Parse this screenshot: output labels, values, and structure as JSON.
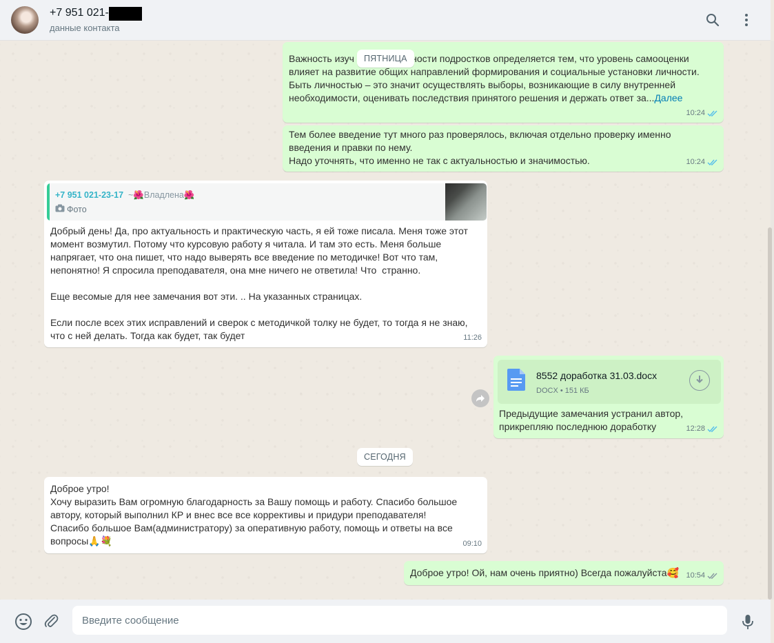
{
  "header": {
    "contact_name": "+7 951 021-",
    "contact_subtitle": "данные контакта",
    "icons": [
      "search-icon",
      "menu-icon"
    ]
  },
  "days": {
    "friday": "ПЯТНИЦА",
    "today": "СЕГОДНЯ"
  },
  "messages": {
    "m1": {
      "text_lead": "Важность изуч",
      "text_rest": " личности подростков определяется тем, что уровень самооценки\nвлияет на развитие общих направлений формирования и социальные установки личности.\nБыть личностью – это значит осуществлять выборы, возникающие в силу внутренней\nнеобходимости, оценивать последствия принятого решения и держать ответ за...",
      "more": "Далее",
      "time": "10:24"
    },
    "m2": {
      "text": "Тем более введение тут много раз проверялось, включая отдельно проверку именно\nвведения и правки по нему.\nНадо уточнять, что именно не так с актуальностью и значимостью.",
      "time": "10:24"
    },
    "m3": {
      "quote_author": "+7 951 021-23-17",
      "quote_alias": "~🌺Владлена🌺",
      "quote_type": "Фото",
      "text": "Добрый день! Да, про актуальность и практическую часть, я ей тоже писала. Меня тоже этот\nмомент возмутил. Потому что курсовую работу я читала. И там это есть. Меня больше\nнапрягает, что она пишет, что надо выверять все введение по методичке! Вот что там,\nнепонятно! Я спросила преподавателя, она мне ничего не ответила! Что  странно.\n\nЕще весомые для нее замечания вот эти. .. На указанных страницах.\n\nЕсли после всех этих исправлений и сверок с методичкой толку не будет, то тогда я не знаю,\nчто с ней делать. Тогда как будет, так будет",
      "time": "11:26"
    },
    "m4": {
      "doc_name": "8552 доработка 31.03.docx",
      "doc_info": "DOCX • 151 КБ",
      "text": "Предыдущие замечания устранил автор,\nприкрепляю последнюю доработку",
      "time": "12:28"
    },
    "m5": {
      "text": "Доброе утро!\nХочу выразить Вам огромную благодарность за Вашу помощь и работу. Спасибо большое\nавтору, который выполнил КР и внес все все коррективы и придури преподавателя!\nСпасибо большое Вам(администратору) за оперативную работу, помощь и ответы на все\nвопросы🙏💐",
      "time": "09:10"
    },
    "m6": {
      "text": "Доброе утро! Ой, нам очень приятно) Всегда пожалуйста🥰",
      "time": "10:54"
    }
  },
  "composer": {
    "placeholder": "Введите сообщение"
  },
  "colors": {
    "outgoing": "#d9fdd3",
    "incoming": "#ffffff",
    "read_ticks": "#53bdeb",
    "link": "#027eb5"
  }
}
